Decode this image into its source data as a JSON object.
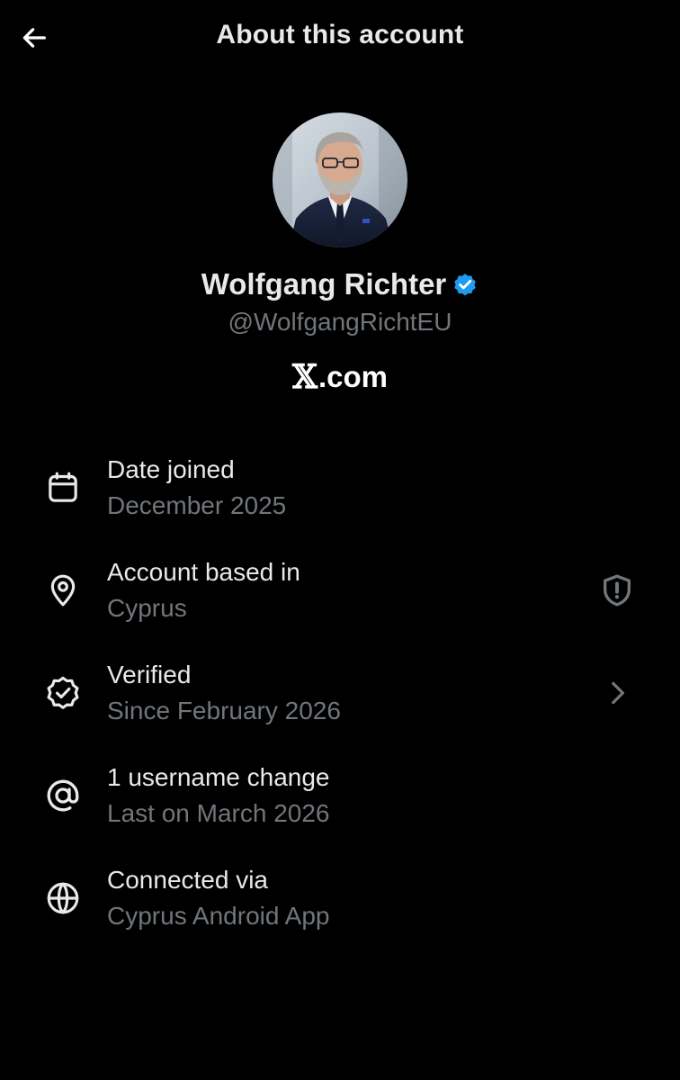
{
  "header": {
    "title": "About this account",
    "back_icon": "back-arrow-icon"
  },
  "profile": {
    "name": "Wolfgang Richter",
    "handle": "@WolfgangRichtEU",
    "verified": true,
    "badge_color": "#1d9bf0",
    "site_mark": "𝕏",
    "site_suffix": ".com"
  },
  "items": [
    {
      "icon": "calendar-icon",
      "title": "Date joined",
      "subtitle": "December 2025"
    },
    {
      "icon": "location-pin-icon",
      "title": "Account based in",
      "subtitle": "Cyprus",
      "trailing_icon": "shield-alert-icon"
    },
    {
      "icon": "verified-check-icon",
      "title": "Verified",
      "subtitle": "Since February 2026",
      "trailing_icon": "chevron-right-icon"
    },
    {
      "icon": "at-sign-icon",
      "title": "1 username change",
      "subtitle": "Last on March 2026"
    },
    {
      "icon": "globe-icon",
      "title": "Connected via",
      "subtitle": "Cyprus Android App"
    }
  ],
  "colors": {
    "background": "#000000",
    "primary_text": "#e7e9ea",
    "secondary_text": "#71767b",
    "accent": "#1d9bf0"
  }
}
